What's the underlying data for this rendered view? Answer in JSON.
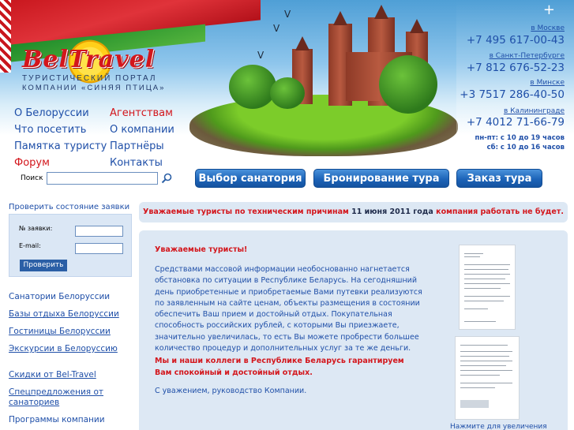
{
  "brand": {
    "logo": "BelTravel",
    "tagline1": "ТУРИСТИЧЕСКИЙ ПОРТАЛ",
    "tagline2": "КОМПАНИИ «СИНЯЯ ПТИЦА»",
    "colors": {
      "red": "#d3161c",
      "blue": "#1f4fa8",
      "tab": "#1d64b8",
      "panel": "#dde8f4"
    }
  },
  "contacts": [
    {
      "city": "в Москве",
      "phone": "+7 495 617-00-43"
    },
    {
      "city": "в Санкт-Петербурге",
      "phone": "+7 812 676-52-23"
    },
    {
      "city": "в Минске",
      "phone": "+3 7517 286-40-50"
    },
    {
      "city": "в Калининграде",
      "phone": "+7 4012 71-66-79"
    }
  ],
  "hours": {
    "weekdays": "пн-пт: с 10 до 19 часов",
    "saturday": "сб: с 10 до 16 часов"
  },
  "nav": {
    "left": [
      "О Белоруссии",
      "Что посетить",
      "Памятка туристу",
      "Форум"
    ],
    "right": [
      "Агентствам",
      "О компании",
      "Партнёры",
      "Контакты"
    ]
  },
  "search": {
    "label": "Поиск",
    "icon": "search-icon"
  },
  "tabs": [
    "Выбор санатория",
    "Бронирование тура",
    "Заказ тура"
  ],
  "sidebar": {
    "check_title": "Проверить состояние заявки",
    "order_label": "№ заявки:",
    "email_label": "E-mail:",
    "check_button": "Проверить",
    "links": [
      "Санатории Белоруссии",
      "Базы отдыха Белоруссии",
      "Гостиницы Белоруссии",
      "Экскурсии в Белоруссию",
      "Скидки от Bel-Travel",
      "Спецпредложения от",
      "санаториев",
      "Программы компании"
    ]
  },
  "notice": {
    "part1": "Уважаемые туристы по техническим причинам",
    "date": "11 июня 2011 года",
    "part2": "компания работать не будет."
  },
  "content": {
    "greeting": "Уважаемые туристы!",
    "body": "Средствами массовой информации необоснованно нагнетается обстановка по ситуации в Республике Беларусь. На сегодняшний день приобретенные и приобретаемые Вами путевки реализуются по заявленным на сайте ценам, объекты размещения в состоянии обеспечить Ваш прием и достойный отдых. Покупательная способность российских рублей, с которыми Вы приезжаете, значительно увеличилась, то есть Вы можете пробрести большее количество процедур и дополнительных услуг за те же деньги.",
    "highlight": "Мы и наши коллеги в Республике Беларусь гарантируем Вам спокойный и достойный отдых.",
    "signature": "С уважением, руководство Компании.",
    "zoom": "Нажмите для увеличения"
  }
}
